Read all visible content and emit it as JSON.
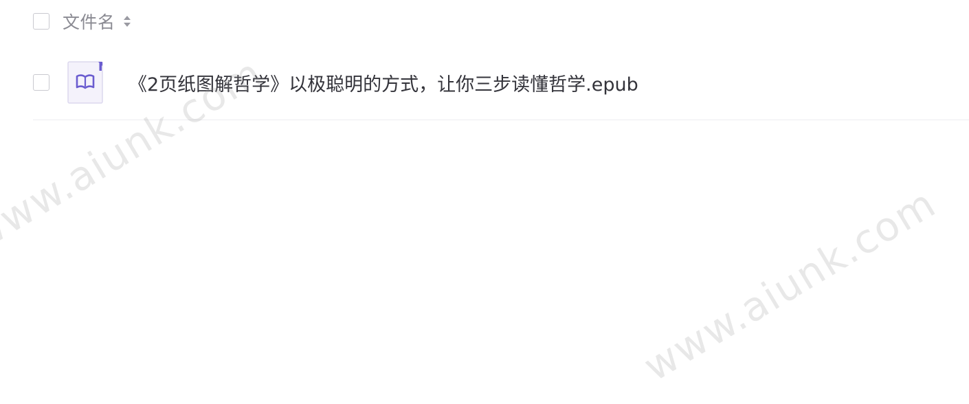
{
  "table": {
    "header": {
      "select_all_checked": false,
      "column_label": "文件名",
      "sort_icon": "sort-icon"
    },
    "rows": [
      {
        "checked": false,
        "file_icon": "epub-book-icon",
        "name": "《2页纸图解哲学》以极聪明的方式，让你三步读懂哲学.epub"
      }
    ]
  },
  "watermark": {
    "text": "www.aiunk.com"
  },
  "colors": {
    "icon_accent": "#6a5ccf",
    "icon_bg": "#f4f2fb"
  }
}
